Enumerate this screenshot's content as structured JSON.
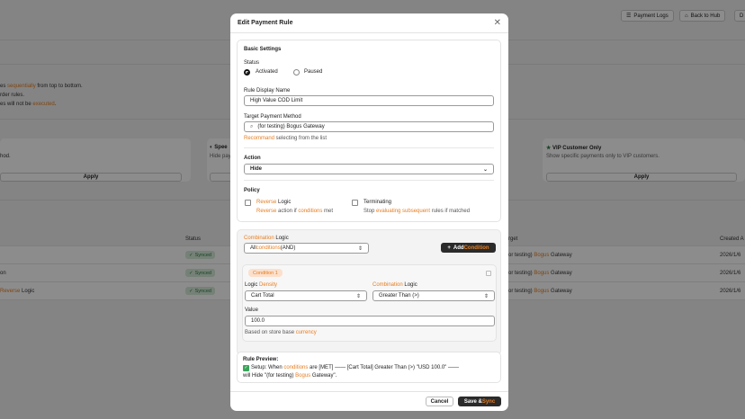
{
  "background": {
    "topbar": {
      "payment_logs": "Payment Logs",
      "back_to_hub": "Back to Hub",
      "extra": "D"
    },
    "info_lines": [
      {
        "a": "es ",
        "b": "sequentially",
        "c": " from top to bottom."
      },
      {
        "a": "rder rules.",
        "b": "",
        "c": ""
      },
      {
        "a": "es will not be ",
        "b": "executed",
        "c": "."
      }
    ],
    "cards": [
      {
        "title": "Spee",
        "desc": "Hide pay",
        "apply": ""
      },
      {
        "title": "VIP Customer Only",
        "desc": "Show specific payments only to VIP customers.",
        "apply": "Apply"
      }
    ],
    "left_card": {
      "desc": "hod.",
      "apply": "Apply"
    },
    "table": {
      "headers": {
        "status": "Status",
        "target": "rget",
        "created": "Created A"
      },
      "rows": [
        {
          "name": "",
          "name_orange": "",
          "status": "Synced",
          "target_a": "or testing) ",
          "target_b": "Bogus",
          "target_c": " Gateway",
          "created": "2026/1/6"
        },
        {
          "name": "on",
          "name_orange": "",
          "status": "Synced",
          "target_a": "or testing) ",
          "target_b": "Bogus",
          "target_c": " Gateway",
          "created": "2026/1/6"
        },
        {
          "name": " Logic",
          "name_orange": "Reverse",
          "status": "Synced",
          "target_a": "or testing) ",
          "target_b": "Bogus",
          "target_c": " Gateway",
          "created": "2026/1/6"
        }
      ]
    }
  },
  "modal": {
    "title": "Edit Payment Rule",
    "basic": {
      "heading": "Basic Settings",
      "status_label": "Status",
      "activated": "Activated",
      "paused": "Paused",
      "display_name_label": "Rule Display Name",
      "display_name_value": "High Value COD Limit",
      "target_label": "Target Payment Method",
      "target_value": "(for testing) Bogus Gateway",
      "hint_orange": "Recommand",
      "hint_rest": " selecting from the list",
      "action_label": "Action",
      "action_value": "Hide",
      "policy_label": "Policy",
      "reverse_a": "Reverse",
      "reverse_b": " Logic",
      "reverse_desc_a": "Reverse",
      "reverse_desc_b": " action if ",
      "reverse_desc_c": "conditions",
      "reverse_desc_d": " met",
      "terminating": "Terminating",
      "term_desc_a": "Stop ",
      "term_desc_b": "evaluating subsequent",
      "term_desc_c": " rules if matched"
    },
    "combination": {
      "label_orange": "Combination",
      "label_rest": " Logic",
      "value_a": "All ",
      "value_b": "conditions",
      "value_c": " (AND)",
      "add_a": "Add ",
      "add_b": "Condition"
    },
    "condition": {
      "tag": "Condition 1",
      "logic_label_a": "Logic ",
      "logic_label_b": "Density",
      "logic_value": "Cart Total",
      "comb_label_a": "Combination",
      "comb_label_b": " Logic",
      "comb_value": "Greater Than (>)",
      "value_label": "Value",
      "value_value": "100.0",
      "note_a": "Based on store base ",
      "note_b": "currency"
    },
    "preview": {
      "heading": "Rule Preview:",
      "line1_a": "Setup: When ",
      "line1_b": "conditions",
      "line1_c": " are [MET] —— [Cart Total] Greater Than (>) \"USD 100.0\" ——",
      "line2_a": "will Hide \"(for testing) ",
      "line2_b": "Bogus",
      "line2_c": " Gateway\"."
    },
    "footer": {
      "cancel": "Cancel",
      "save_a": "Save & ",
      "save_b": "Sync"
    }
  },
  "colors": {
    "accent": "#e67e22",
    "dark_button": "#2b2b2b",
    "synced_bg": "#d5ecd9"
  }
}
